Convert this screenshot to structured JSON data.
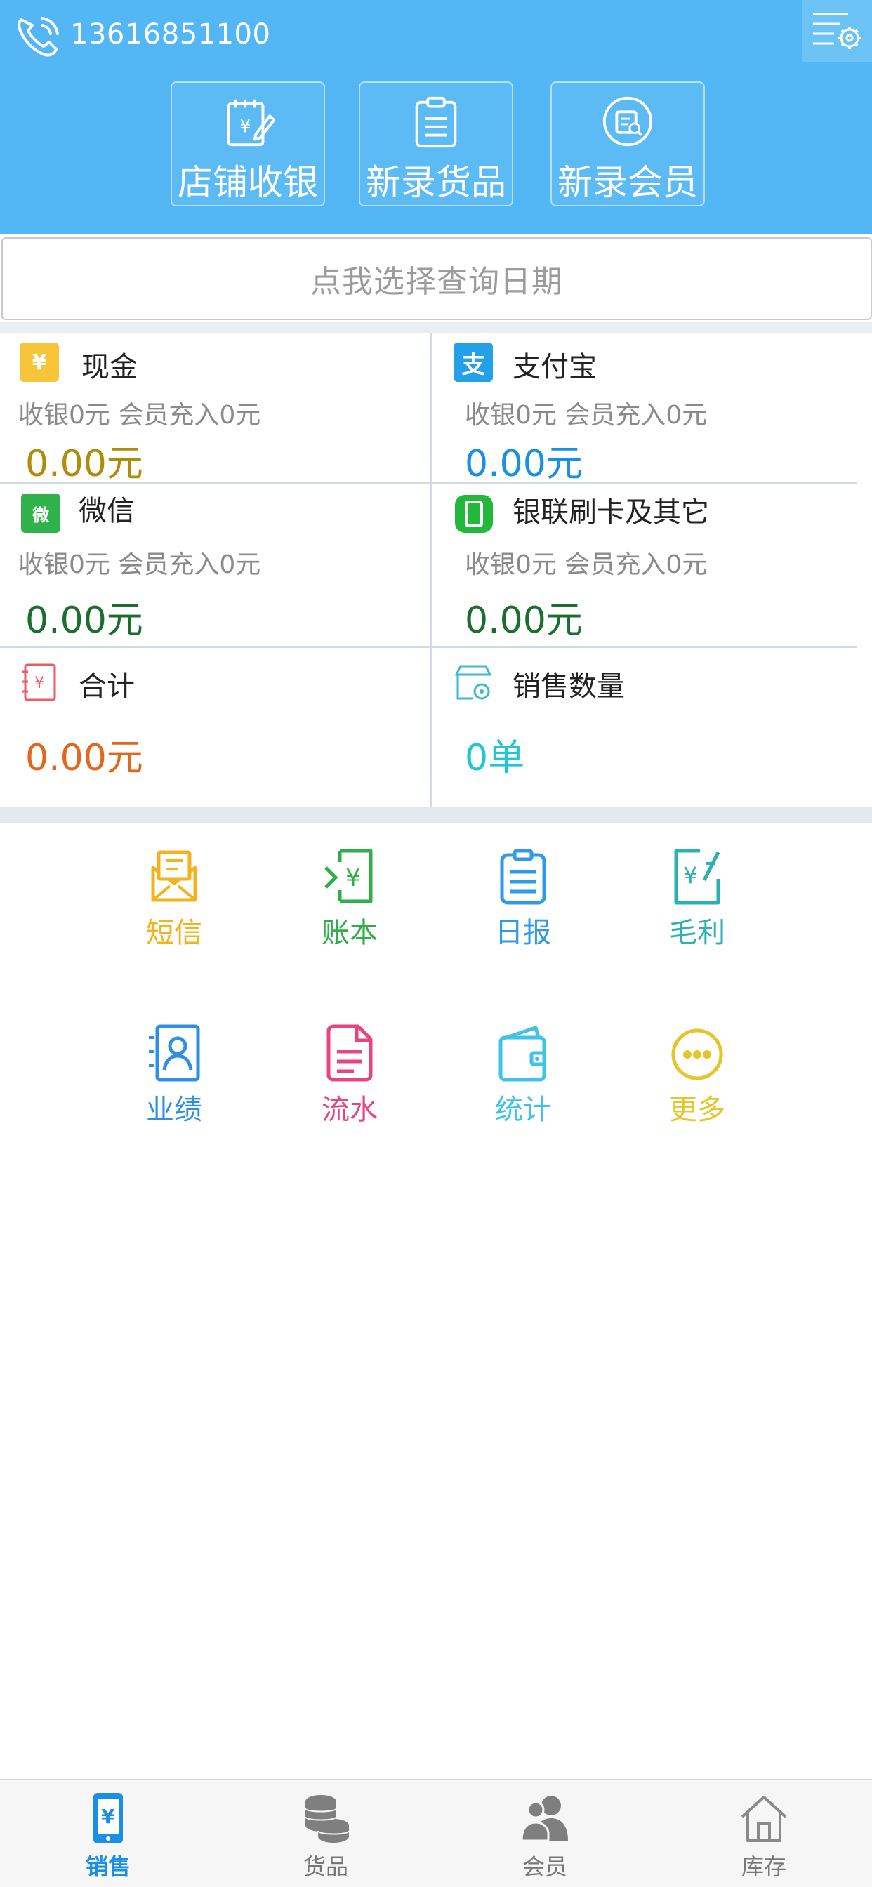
{
  "header": {
    "phone_number": "13616851100",
    "quick_actions": [
      {
        "label": "店铺收银",
        "icon": "cash-register-icon"
      },
      {
        "label": "新录货品",
        "icon": "clipboard-icon"
      },
      {
        "label": "新录会员",
        "icon": "member-card-icon"
      }
    ]
  },
  "date_selector": {
    "label": "点我选择查询日期"
  },
  "stats": {
    "cash": {
      "title": "现金",
      "icon_text": "¥",
      "sub": "收银0元 会员充入0元",
      "amount": "0.00元"
    },
    "alipay": {
      "title": "支付宝",
      "icon_text": "支",
      "sub": "收银0元 会员充入0元",
      "amount": "0.00元"
    },
    "wechat": {
      "title": "微信",
      "icon_text": "微",
      "sub": "收银0元 会员充入0元",
      "amount": "0.00元"
    },
    "unionpay": {
      "title": "银联刷卡及其它",
      "sub": "收银0元 会员充入0元",
      "amount": "0.00元"
    },
    "total": {
      "title": "合计",
      "amount": "0.00元"
    },
    "sales_count": {
      "title": "销售数量",
      "amount": "0单"
    }
  },
  "functions": [
    {
      "label": "短信",
      "icon": "sms-icon",
      "color": "#f2b31c"
    },
    {
      "label": "账本",
      "icon": "ledger-icon",
      "color": "#2fae4a"
    },
    {
      "label": "日报",
      "icon": "daily-report-icon",
      "color": "#2f9be6"
    },
    {
      "label": "毛利",
      "icon": "gross-profit-icon",
      "color": "#2bb0b3"
    },
    {
      "label": "业绩",
      "icon": "performance-icon",
      "color": "#2f8fe3"
    },
    {
      "label": "流水",
      "icon": "transactions-icon",
      "color": "#e6457f"
    },
    {
      "label": "统计",
      "icon": "wallet-icon",
      "color": "#3fc3e6"
    },
    {
      "label": "更多",
      "icon": "more-icon",
      "color": "#e4c52a"
    }
  ],
  "tabs": [
    {
      "label": "销售",
      "icon": "phone-yen-icon",
      "active": true
    },
    {
      "label": "货品",
      "icon": "coins-stack-icon",
      "active": false
    },
    {
      "label": "会员",
      "icon": "members-icon",
      "active": false
    },
    {
      "label": "库存",
      "icon": "house-icon",
      "active": false
    }
  ],
  "colors": {
    "header_bg": "#52b7f4",
    "accent_blue": "#1a8fe3",
    "cash_amount": "#b08c0c",
    "alipay_amount": "#1a8fe3",
    "green_amount": "#1b6e2e",
    "total_amount": "#e2671c",
    "count_amount": "#20c6d6",
    "tab_inactive": "#777777"
  }
}
